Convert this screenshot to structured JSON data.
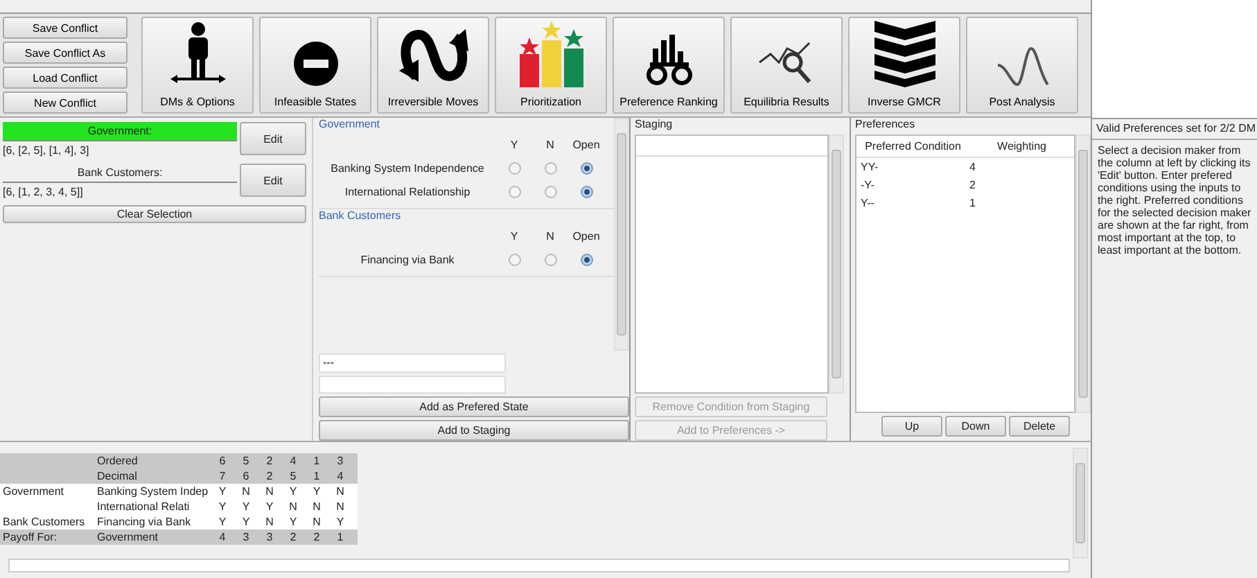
{
  "file_buttons": [
    "Save Conflict",
    "Save Conflict As",
    "Load Conflict",
    "New Conflict"
  ],
  "tools": [
    {
      "label": "DMs & Options",
      "kind": "person"
    },
    {
      "label": "Infeasible States",
      "kind": "noentry"
    },
    {
      "label": "Irreversible Moves",
      "kind": "loop"
    },
    {
      "label": "Prioritization",
      "kind": "podium"
    },
    {
      "label": "Preference Ranking",
      "kind": "glasses"
    },
    {
      "label": "Equilibria Results",
      "kind": "magnifier"
    },
    {
      "label": "Inverse GMCR",
      "kind": "chevrons"
    },
    {
      "label": "Post Analysis",
      "kind": "wave"
    }
  ],
  "dms": [
    {
      "name": "Government:",
      "ranking": "[6, [2, 5], [1, 4], 3]",
      "selected": true,
      "edit": "Edit"
    },
    {
      "name": "Bank Customers:",
      "ranking": "[6, [1, 2, 3, 4, 5]]",
      "selected": false,
      "edit": "Edit"
    }
  ],
  "clear_button": "Clear Selection",
  "option_groups": [
    {
      "dm": "Government",
      "headers": [
        "Y",
        "N",
        "Open"
      ],
      "options": [
        {
          "label": "Banking System Independence",
          "choices": [
            {
              "selected": false
            },
            {
              "selected": false
            },
            {
              "selected": true
            }
          ]
        },
        {
          "label": "International Relationship",
          "choices": [
            {
              "selected": false
            },
            {
              "selected": false
            },
            {
              "selected": true
            }
          ]
        }
      ]
    },
    {
      "dm": "Bank Customers",
      "headers": [
        "Y",
        "N",
        "Open"
      ],
      "options": [
        {
          "label": "Financing via Bank",
          "choices": [
            {
              "selected": false
            },
            {
              "selected": false
            },
            {
              "selected": true
            }
          ]
        }
      ]
    }
  ],
  "condition_field": {
    "value": "---"
  },
  "option_buttons": [
    "Add as Prefered State",
    "Add to Staging"
  ],
  "staging": {
    "title": "Staging",
    "buttons": [
      {
        "label": "Remove Condition from Staging",
        "disabled": true
      },
      {
        "label": "Add to Preferences ->",
        "disabled": true
      }
    ]
  },
  "preferences": {
    "title": "Preferences",
    "columns": [
      "Preferred Condition",
      "Weighting"
    ],
    "rows": [
      {
        "condition": "YY-",
        "weighting": "4"
      },
      {
        "condition": "-Y-",
        "weighting": "2"
      },
      {
        "condition": "Y--",
        "weighting": "1"
      }
    ],
    "buttons": [
      "Up",
      "Down",
      "Delete"
    ]
  },
  "info": {
    "status": "Valid Preferences set for 2/2 DM",
    "help": "Select a decision maker from the column at left by clicking its 'Edit' button. Enter prefered conditions using the inputs to the right.  Preferred conditions for the selected decision maker are shown at the far right, from most important at the top, to least important at the bottom."
  },
  "state_table": [
    {
      "kind": "header",
      "option": "Ordered",
      "values": [
        "6",
        "5",
        "2",
        "4",
        "1",
        "3"
      ]
    },
    {
      "kind": "header",
      "option": "Decimal",
      "values": [
        "7",
        "6",
        "2",
        "5",
        "1",
        "4"
      ]
    },
    {
      "kind": "body",
      "dm": "Government",
      "option": "Banking System Indep",
      "values": [
        "Y",
        "N",
        "N",
        "Y",
        "Y",
        "N"
      ]
    },
    {
      "kind": "body",
      "option": "International Relati",
      "values": [
        "Y",
        "Y",
        "Y",
        "N",
        "N",
        "N"
      ]
    },
    {
      "kind": "body",
      "dm": "Bank Customers",
      "option": "Financing via Bank",
      "values": [
        "Y",
        "Y",
        "N",
        "Y",
        "N",
        "Y"
      ]
    },
    {
      "kind": "footer",
      "dm": "Payoff For:",
      "option": "Government",
      "values": [
        "4",
        "3",
        "3",
        "2",
        "2",
        "1"
      ]
    }
  ]
}
